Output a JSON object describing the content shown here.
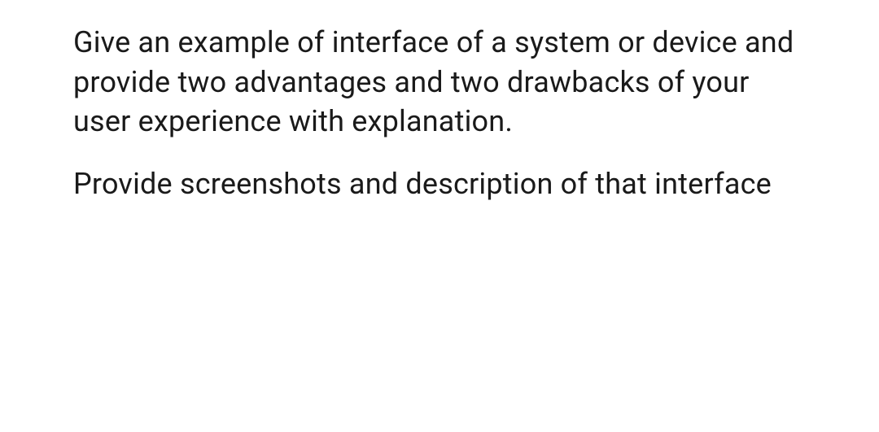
{
  "paragraphs": [
    "Give an example of interface of a system or device and provide two advantages and two drawbacks of your user experience with explanation.",
    "Provide screenshots and description of that interface"
  ]
}
